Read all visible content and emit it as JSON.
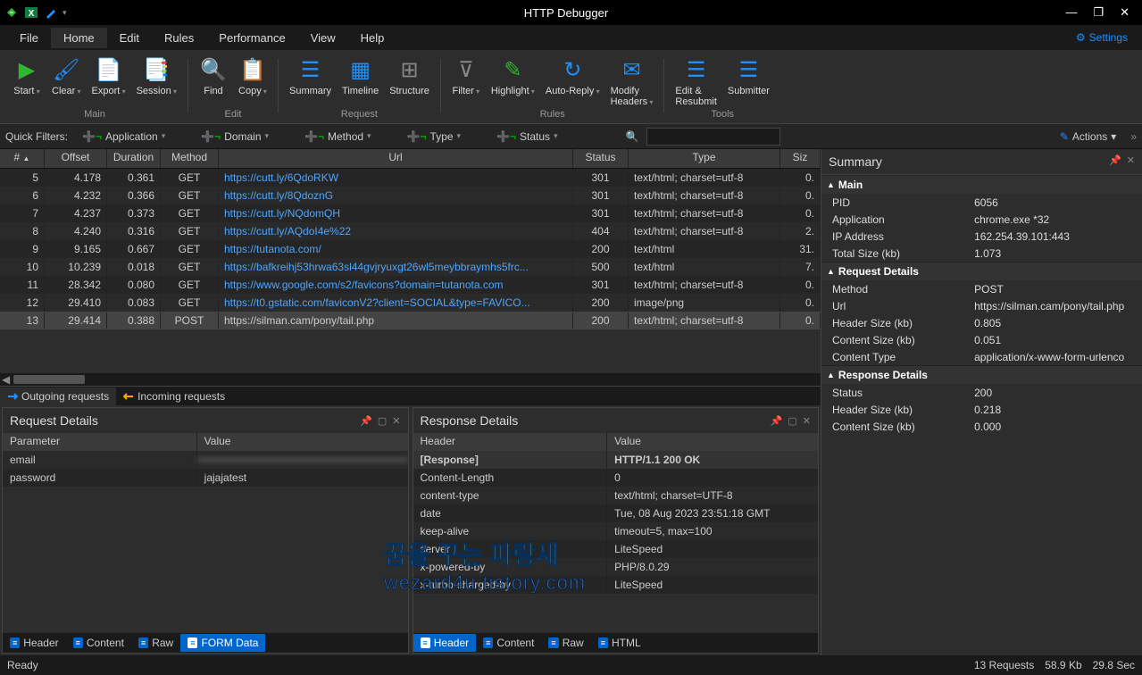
{
  "title": "HTTP Debugger",
  "settings_label": "Settings",
  "menu": [
    "File",
    "Home",
    "Edit",
    "Rules",
    "Performance",
    "View",
    "Help"
  ],
  "menu_active": 1,
  "ribbon": {
    "groups": [
      {
        "label": "Main",
        "items": [
          {
            "name": "start",
            "label": "Start",
            "color": "#2db82d",
            "dd": true
          },
          {
            "name": "clear",
            "label": "Clear",
            "color": "#1e90ff",
            "dd": true
          },
          {
            "name": "export",
            "label": "Export",
            "color": "#1e90ff",
            "dd": true
          },
          {
            "name": "session",
            "label": "Session",
            "color": "#1e90ff",
            "dd": true
          }
        ]
      },
      {
        "label": "Edit",
        "items": [
          {
            "name": "find",
            "label": "Find",
            "color": "#1e90ff",
            "dd": false
          },
          {
            "name": "copy",
            "label": "Copy",
            "color": "#ccc",
            "dd": true
          }
        ]
      },
      {
        "label": "Request",
        "items": [
          {
            "name": "summary",
            "label": "Summary",
            "color": "#1e90ff"
          },
          {
            "name": "timeline",
            "label": "Timeline",
            "color": "#1e90ff"
          },
          {
            "name": "structure",
            "label": "Structure",
            "color": "#888"
          }
        ]
      },
      {
        "label": "Rules",
        "items": [
          {
            "name": "filter",
            "label": "Filter",
            "color": "#888",
            "dd": true
          },
          {
            "name": "highlight",
            "label": "Highlight",
            "color": "#2db82d",
            "dd": true
          },
          {
            "name": "autoreply",
            "label": "Auto-Reply",
            "color": "#1e90ff",
            "dd": true
          },
          {
            "name": "modifyheaders",
            "label": "Modify\nHeaders",
            "color": "#1e90ff",
            "dd": true
          }
        ]
      },
      {
        "label": "Tools",
        "items": [
          {
            "name": "editresubmit",
            "label": "Edit &\nResubmit",
            "color": "#1e90ff"
          },
          {
            "name": "submitter",
            "label": "Submitter",
            "color": "#1e90ff"
          }
        ]
      }
    ]
  },
  "quickfilters": {
    "label": "Quick Filters:",
    "items": [
      "Application",
      "Domain",
      "Method",
      "Type",
      "Status"
    ],
    "actions": "Actions"
  },
  "grid": {
    "cols": [
      "#",
      "Offset",
      "Duration",
      "Method",
      "Url",
      "Status",
      "Type",
      "Siz"
    ],
    "rows": [
      {
        "n": 5,
        "offset": "4.178",
        "dur": "0.361",
        "m": "GET",
        "url": "https://cutt.ly/6QdoRKW",
        "st": "301",
        "type": "text/html; charset=utf-8",
        "sz": "0."
      },
      {
        "n": 6,
        "offset": "4.232",
        "dur": "0.366",
        "m": "GET",
        "url": "https://cutt.ly/8QdoznG",
        "st": "301",
        "type": "text/html; charset=utf-8",
        "sz": "0."
      },
      {
        "n": 7,
        "offset": "4.237",
        "dur": "0.373",
        "m": "GET",
        "url": "https://cutt.ly/NQdomQH",
        "st": "301",
        "type": "text/html; charset=utf-8",
        "sz": "0."
      },
      {
        "n": 8,
        "offset": "4.240",
        "dur": "0.316",
        "m": "GET",
        "url": "https://cutt.ly/AQdoI4e%22",
        "st": "404",
        "type": "text/html; charset=utf-8",
        "sz": "2."
      },
      {
        "n": 9,
        "offset": "9.165",
        "dur": "0.667",
        "m": "GET",
        "url": "https://tutanota.com/",
        "st": "200",
        "type": "text/html",
        "sz": "31."
      },
      {
        "n": 10,
        "offset": "10.239",
        "dur": "0.018",
        "m": "GET",
        "url": "https://bafkreihj53hrwa63sl44gvjryuxgt26wl5meybbraymhs5frc...",
        "st": "500",
        "type": "text/html",
        "sz": "7."
      },
      {
        "n": 11,
        "offset": "28.342",
        "dur": "0.080",
        "m": "GET",
        "url": "https://www.google.com/s2/favicons?domain=tutanota.com",
        "st": "301",
        "type": "text/html; charset=utf-8",
        "sz": "0."
      },
      {
        "n": 12,
        "offset": "29.410",
        "dur": "0.083",
        "m": "GET",
        "url": "https://t0.gstatic.com/faviconV2?client=SOCIAL&type=FAVICO...",
        "st": "200",
        "type": "image/png",
        "sz": "0."
      },
      {
        "n": 13,
        "offset": "29.414",
        "dur": "0.388",
        "m": "POST",
        "url": "https://silman.cam/pony/tail.php",
        "st": "200",
        "type": "text/html; charset=utf-8",
        "sz": "0.",
        "sel": true
      }
    ]
  },
  "tabs": {
    "outgoing": "Outgoing requests",
    "incoming": "Incoming requests"
  },
  "request_panel": {
    "title": "Request Details",
    "head": [
      "Parameter",
      "Value"
    ],
    "rows": [
      {
        "k": "email",
        "v": "",
        "blur": true
      },
      {
        "k": "password",
        "v": "jajajatest"
      }
    ],
    "tabs": [
      "Header",
      "Content",
      "Raw",
      "FORM Data"
    ],
    "active_tab": 3
  },
  "response_panel": {
    "title": "Response Details",
    "head": [
      "Header",
      "Value"
    ],
    "rows": [
      {
        "k": "[Response]",
        "v": "HTTP/1.1 200 OK",
        "bold": true
      },
      {
        "k": "Content-Length",
        "v": "0"
      },
      {
        "k": "content-type",
        "v": "text/html; charset=UTF-8"
      },
      {
        "k": "date",
        "v": "Tue, 08 Aug 2023 23:51:18 GMT"
      },
      {
        "k": "keep-alive",
        "v": "timeout=5, max=100"
      },
      {
        "k": "server",
        "v": "LiteSpeed"
      },
      {
        "k": "x-powered-by",
        "v": "PHP/8.0.29"
      },
      {
        "k": "x-turbo-charged-by",
        "v": "LiteSpeed"
      }
    ],
    "tabs": [
      "Header",
      "Content",
      "Raw",
      "HTML"
    ],
    "active_tab": 0
  },
  "summary": {
    "title": "Summary",
    "groups": [
      {
        "name": "Main",
        "rows": [
          {
            "k": "PID",
            "v": "6056"
          },
          {
            "k": "Application",
            "v": "chrome.exe *32"
          },
          {
            "k": "IP Address",
            "v": "162.254.39.101:443"
          },
          {
            "k": "Total Size (kb)",
            "v": "1.073"
          }
        ]
      },
      {
        "name": "Request Details",
        "rows": [
          {
            "k": "Method",
            "v": "POST"
          },
          {
            "k": "Url",
            "v": "https://silman.cam/pony/tail.php"
          },
          {
            "k": "Header Size (kb)",
            "v": "0.805"
          },
          {
            "k": "Content Size (kb)",
            "v": "0.051"
          },
          {
            "k": "Content Type",
            "v": "application/x-www-form-urlenco"
          }
        ]
      },
      {
        "name": "Response Details",
        "rows": [
          {
            "k": "Status",
            "v": "200"
          },
          {
            "k": "Header Size (kb)",
            "v": "0.218"
          },
          {
            "k": "Content Size (kb)",
            "v": "0.000"
          }
        ]
      }
    ]
  },
  "statusbar": {
    "ready": "Ready",
    "requests": "13 Requests",
    "kb": "58.9 Kb",
    "sec": "29.8 Sec"
  },
  "watermark": {
    "l1": "꿈을 꾸는 파랑새",
    "l2": "wezard4u.tistory.com"
  }
}
